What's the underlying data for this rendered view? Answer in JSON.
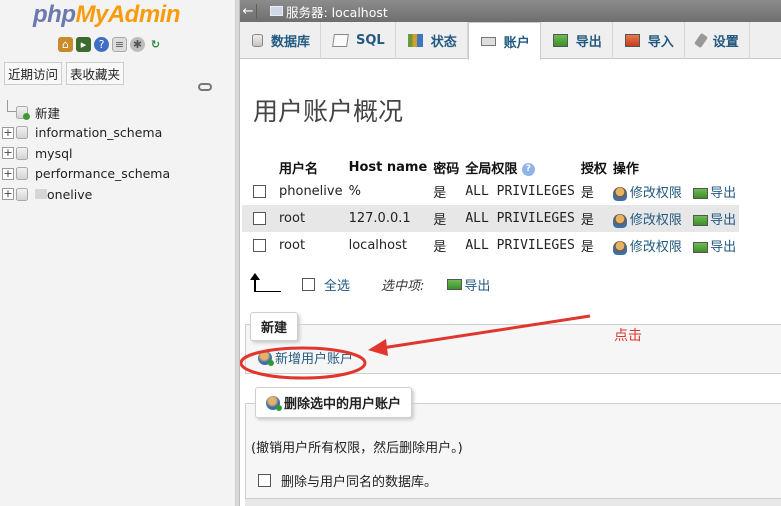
{
  "nav": {
    "logo_php": "php",
    "logo_myadmin": "MyAdmin",
    "link_recent": "近期访问",
    "link_favorites": "表收藏夹",
    "tree": [
      {
        "label": "新建",
        "kind": "new"
      },
      {
        "label": "information_schema",
        "kind": "db"
      },
      {
        "label": "mysql",
        "kind": "db"
      },
      {
        "label": "performance_schema",
        "kind": "db"
      },
      {
        "label": "onelive",
        "kind": "db-blurred"
      }
    ]
  },
  "topbar": {
    "back_glyph": "←",
    "server_label": "服务器: localhost"
  },
  "tabs": [
    {
      "label": "数据库",
      "icon": "database-icon"
    },
    {
      "label": "SQL",
      "icon": "sql-icon"
    },
    {
      "label": "状态",
      "icon": "status-icon"
    },
    {
      "label": "账户",
      "icon": "accounts-icon",
      "active": true
    },
    {
      "label": "导出",
      "icon": "export-icon"
    },
    {
      "label": "导入",
      "icon": "import-icon"
    },
    {
      "label": "设置",
      "icon": "settings-icon"
    }
  ],
  "main": {
    "title": "用户账户概况",
    "table": {
      "headers": [
        "用户名",
        "Host name",
        "密码",
        "全局权限",
        "授权",
        "操作"
      ],
      "rows": [
        {
          "user": "phonelive",
          "host": "%",
          "password": "是",
          "privileges": "ALL PRIVILEGES",
          "grant": "是",
          "edit": "修改权限",
          "export": "导出"
        },
        {
          "user": "root",
          "host": "127.0.0.1",
          "password": "是",
          "privileges": "ALL PRIVILEGES",
          "grant": "是",
          "edit": "修改权限",
          "export": "导出"
        },
        {
          "user": "root",
          "host": "localhost",
          "password": "是",
          "privileges": "ALL PRIVILEGES",
          "grant": "是",
          "edit": "修改权限",
          "export": "导出"
        }
      ]
    },
    "select_all": "全选",
    "with_selected": "选中项:",
    "bulk_export": "导出",
    "new_legend": "新建",
    "add_user": "新增用户账户",
    "remove_legend": "删除选中的用户账户",
    "revoke_text": "(撤销用户所有权限，然后删除用户。)",
    "drop_db_text": "删除与用户同名的数据库。"
  },
  "annotation": {
    "text": "点击",
    "color": "#e0362e"
  }
}
